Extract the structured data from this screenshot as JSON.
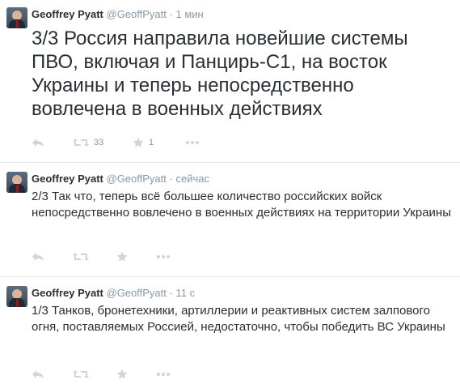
{
  "tweets": [
    {
      "name": "Geoffrey Pyatt",
      "handle": "@GeoffPyatt",
      "dot": "·",
      "time": "1 мин",
      "text": "3/3 Россия направила новейшие системы ПВО, включая и Панцирь-С1, на восток Украины и теперь непосредственно вовлечена в военных действиях",
      "retweets": "33",
      "favorites": "1"
    },
    {
      "name": "Geoffrey Pyatt",
      "handle": "@GeoffPyatt",
      "dot": "·",
      "time": "сейчас",
      "text": "2/3 Так что, теперь всё большее количество российских войск непосредственно вовлечено в военных действиях на территории Украины",
      "retweets": "",
      "favorites": ""
    },
    {
      "name": "Geoffrey Pyatt",
      "handle": "@GeoffPyatt",
      "dot": "·",
      "time": "11 с",
      "text": "1/3 Танков, бронетехники, артиллерии и реактивных систем залпового огня, поставляемых Россией, недостаточно, чтобы победить ВС Украины",
      "retweets": "",
      "favorites": ""
    }
  ],
  "icons": {
    "reply": "reply-icon",
    "retweet": "retweet-icon",
    "favorite": "star-icon",
    "more": "more-icon"
  },
  "colors": {
    "action_icon": "#ccd6dd",
    "meta_text": "#8899a6",
    "divider": "#e1e8ed"
  }
}
